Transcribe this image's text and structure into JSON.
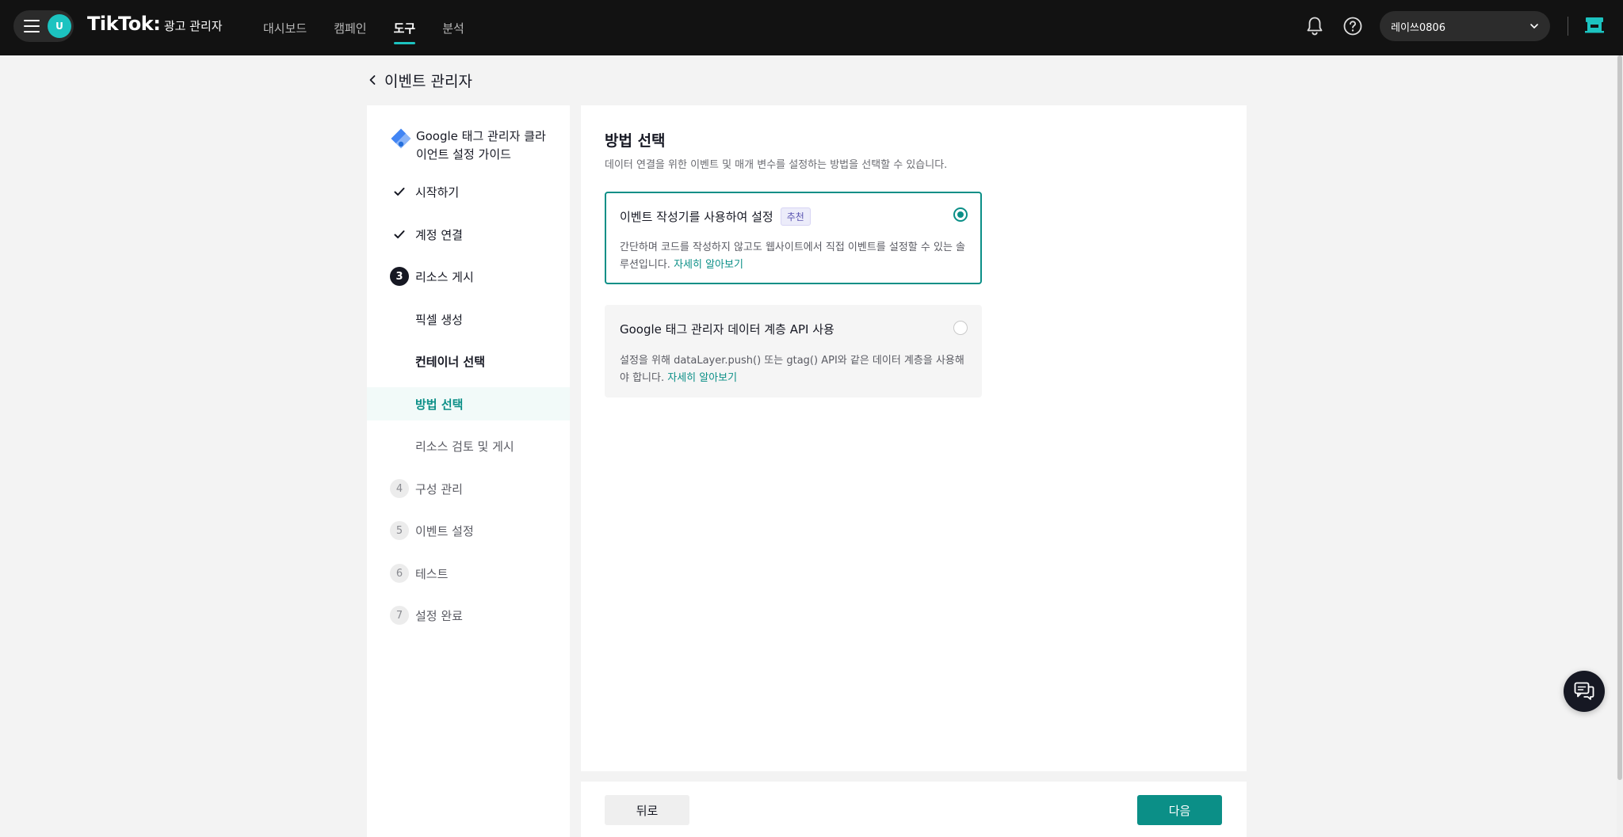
{
  "header": {
    "avatar_initial": "U",
    "brand": "TikTok",
    "brand_colon": ":",
    "brand_sub": "광고 관리자",
    "nav": [
      {
        "label": "대시보드",
        "active": false
      },
      {
        "label": "캠페인",
        "active": false
      },
      {
        "label": "도구",
        "active": true
      },
      {
        "label": "분석",
        "active": false
      }
    ],
    "account_name": "레이쓰0806",
    "accent_color": "#1cc3c0"
  },
  "page": {
    "title": "이벤트 관리자"
  },
  "sidebar": {
    "guide_title": "Google 태그 관리자 클라이언트 설정 가이드",
    "steps": [
      {
        "marker": "check",
        "label": "시작하기"
      },
      {
        "marker": "check",
        "label": "계정 연결"
      },
      {
        "marker": "3",
        "label": "리소스 게시"
      },
      {
        "marker": "",
        "label": "픽셀 생성"
      },
      {
        "marker": "",
        "label": "컨테이너 선택"
      },
      {
        "marker": "",
        "label": "방법 선택"
      },
      {
        "marker": "",
        "label": "리소스 검토 및 게시"
      },
      {
        "marker": "4",
        "label": "구성 관리"
      },
      {
        "marker": "5",
        "label": "이벤트 설정"
      },
      {
        "marker": "6",
        "label": "테스트"
      },
      {
        "marker": "7",
        "label": "설정 완료"
      }
    ]
  },
  "main": {
    "title": "방법 선택",
    "description": "데이터 연결을 위한 이벤트 및 매개 변수를 설정하는 방법을 선택할 수 있습니다.",
    "options": [
      {
        "title": "이벤트 작성기를 사용하여 설정",
        "badge": "추천",
        "selected": true,
        "description": "간단하며 코드를 작성하지 않고도 웹사이트에서 직접 이벤트를 설정할 수 있는 솔루션입니다.",
        "link": "자세히 알아보기"
      },
      {
        "title": "Google 태그 관리자 데이터 계층 API 사용",
        "badge": "",
        "selected": false,
        "description": "설정을 위해 dataLayer.push() 또는 gtag() API와 같은 데이터 계층을 사용해야 합니다.",
        "link": "자세히 알아보기"
      }
    ]
  },
  "footer": {
    "back_label": "뒤로",
    "next_label": "다음",
    "primary_color": "#0b8f87"
  }
}
